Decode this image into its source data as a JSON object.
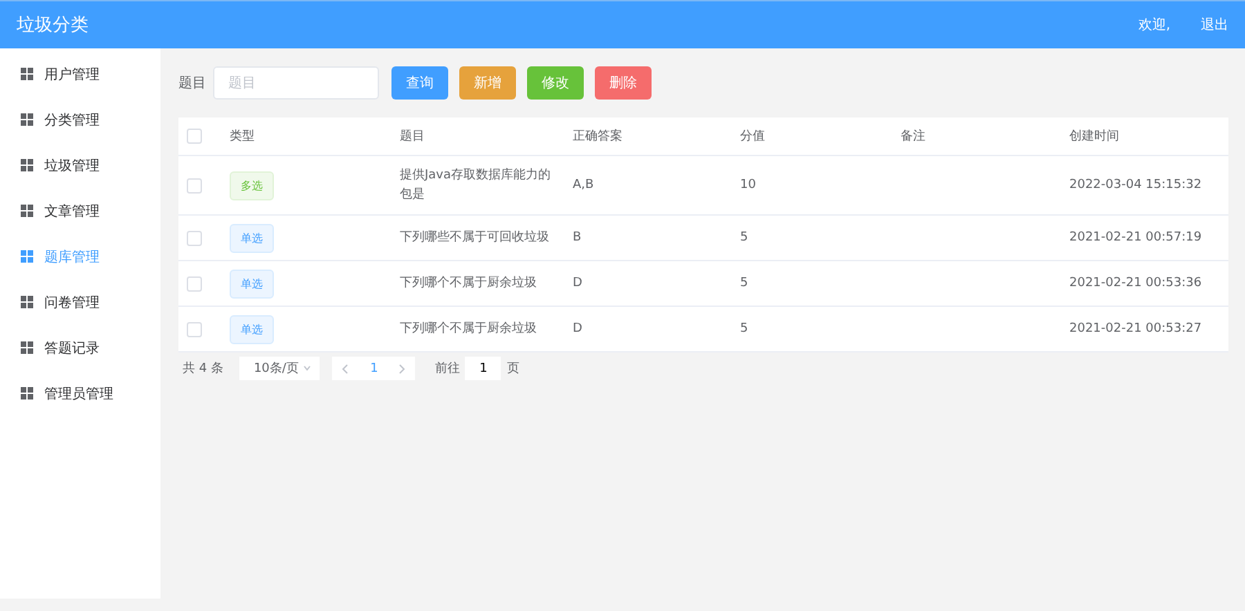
{
  "header": {
    "title": "垃圾分类",
    "welcome": "欢迎,",
    "logout": "退出"
  },
  "sidebar": {
    "items": [
      {
        "label": "用户管理",
        "selected": false
      },
      {
        "label": "分类管理",
        "selected": false
      },
      {
        "label": "垃圾管理",
        "selected": false
      },
      {
        "label": "文章管理",
        "selected": false
      },
      {
        "label": "题库管理",
        "selected": true
      },
      {
        "label": "问卷管理",
        "selected": false
      },
      {
        "label": "答题记录",
        "selected": false
      },
      {
        "label": "管理员管理",
        "selected": false
      }
    ]
  },
  "search": {
    "label": "题目",
    "placeholder": "题目"
  },
  "buttons": [
    {
      "label": "查询",
      "kind": "primary"
    },
    {
      "label": "新增",
      "kind": "warning"
    },
    {
      "label": "修改",
      "kind": "success"
    },
    {
      "label": "删除",
      "kind": "danger"
    }
  ],
  "table": {
    "select_all_checked": false,
    "columns": [
      "类型",
      "题目",
      "正确答案",
      "分值",
      "备注",
      "创建时间"
    ],
    "rows": [
      {
        "checked": false,
        "type": {
          "label": "多选",
          "kind": "multi"
        },
        "title": "提供Java存取数据库能力的包是",
        "answer": "A,B",
        "score": "10",
        "created": "2022-03-04 15:15:32"
      },
      {
        "checked": false,
        "type": {
          "label": "单选",
          "kind": "single"
        },
        "title": "下列哪些不属于可回收垃圾",
        "answer": "B",
        "score": "5",
        "created": "2021-02-21 00:57:19"
      },
      {
        "checked": false,
        "type": {
          "label": "单选",
          "kind": "single"
        },
        "title": "下列哪个不属于厨余垃圾",
        "answer": "D",
        "score": "5",
        "created": "2021-02-21 00:53:36"
      },
      {
        "checked": false,
        "type": {
          "label": "单选",
          "kind": "single"
        },
        "title": "下列哪个不属于厨余垃圾",
        "answer": "D",
        "score": "5",
        "created": "2021-02-21 00:53:27"
      }
    ]
  },
  "pagination": {
    "total": "共 4 条",
    "page_size": "10条/页",
    "pages": [
      {
        "label": "1",
        "selected": true
      }
    ],
    "goto_label": "前往",
    "goto_value": "1",
    "page_suffix": "页"
  }
}
